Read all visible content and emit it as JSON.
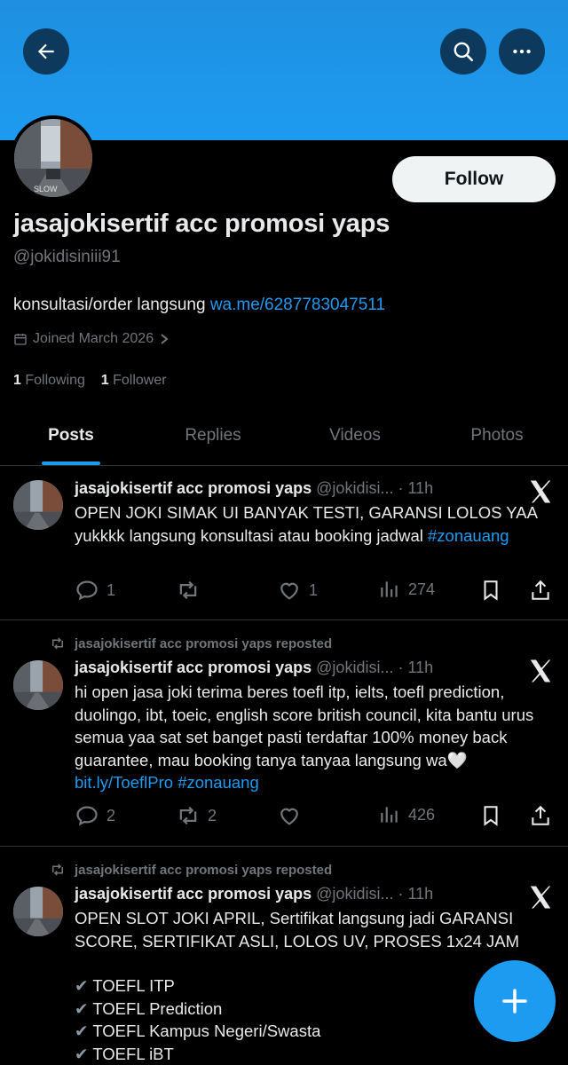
{
  "profile": {
    "name": "jasajokisertif acc promosi yaps",
    "handle": "@jokidisiniii91",
    "bio_text": "konsultasi/order langsung ",
    "bio_link": "wa.me/6287783047511",
    "joined": "Joined March 2026",
    "following_count": "1",
    "following_label": "Following",
    "followers_count": "1",
    "followers_label": "Follower",
    "follow_label": "Follow"
  },
  "tabs": [
    "Posts",
    "Replies",
    "Videos",
    "Photos"
  ],
  "posts": [
    {
      "name": "jasajokisertif acc promosi yaps",
      "handle": "@jokidisi...",
      "time": "· 11h",
      "text": "OPEN JOKI SIMAK UI BANYAK TESTI, GARANSI LOLOS YAA yukkkk langsung konsultasi atau booking jadwal ",
      "hashtag": "#zonauang",
      "replies": "1",
      "reposts": "",
      "likes": "1",
      "views": "274"
    },
    {
      "repost_label": "jasajokisertif acc promosi yaps reposted",
      "name": "jasajokisertif acc promosi yaps",
      "handle": "@jokidisi...",
      "time": "· 11h",
      "text": "hi open jasa joki terima beres toefl itp, ielts, toefl prediction, duolingo, ibt, toeic, english score british council, kita bantu urus semua yaa sat set banget pasti terdaftar 100% money back guarantee, mau booking tanya tanyaa langsung wa🤍 ",
      "link": "bit.ly/ToeflPro",
      "hashtag": "#zonauang",
      "replies": "2",
      "reposts": "2",
      "likes": "",
      "views": "426"
    },
    {
      "repost_label": "jasajokisertif acc promosi yaps reposted",
      "name": "jasajokisertif acc promosi yaps",
      "handle": "@jokidisi...",
      "time": "· 11h",
      "text": "OPEN SLOT JOKI APRIL, Sertifikat langsung jadi GARANSI SCORE, SERTIFIKAT ASLI, LOLOS UV, PROSES 1x24 JAM",
      "list": [
        "TOEFL ITP",
        "TOEFL Prediction",
        "TOEFL Kampus Negeri/Swasta",
        "TOEFL iBT"
      ]
    }
  ],
  "colors": {
    "accent": "#1d9bf0",
    "muted": "#71767b",
    "text": "#e7e9ea",
    "background": "#000000"
  },
  "icons": [
    "back-arrow-icon",
    "search-icon",
    "more-icon",
    "calendar-icon",
    "chevron-right-icon",
    "x-logo-icon",
    "reply-icon",
    "repost-icon",
    "like-icon",
    "views-icon",
    "bookmark-icon",
    "share-icon",
    "plus-icon"
  ]
}
